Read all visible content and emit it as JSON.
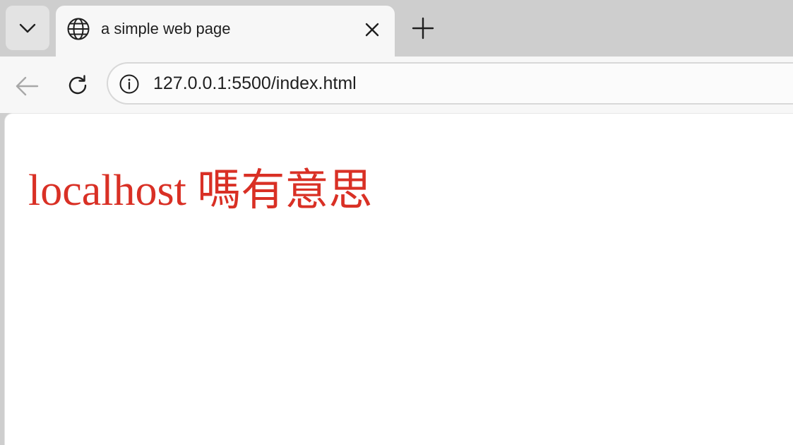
{
  "tab": {
    "title": "a simple web page",
    "favicon": "globe-icon"
  },
  "toolbar": {
    "url": "127.0.0.1:5500/index.html"
  },
  "page": {
    "heading": "localhost 嗎有意思",
    "heading_color": "#d93025"
  },
  "icons": {
    "tab_list": "chevron-down-icon",
    "tab_close": "close-icon",
    "new_tab": "plus-icon",
    "back": "back-arrow-icon",
    "reload": "reload-icon",
    "site_info": "info-icon"
  }
}
